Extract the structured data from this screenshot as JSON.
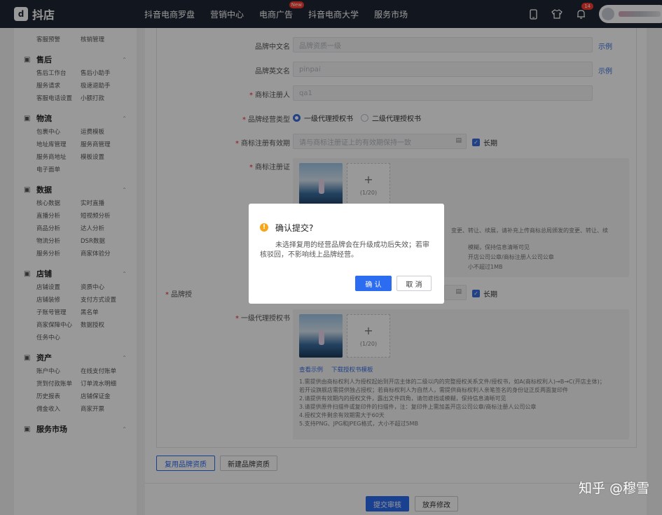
{
  "app": {
    "logo_text": "抖店"
  },
  "nav": {
    "items": [
      "抖音电商罗盘",
      "营销中心",
      "电商广告",
      "抖音电商大学",
      "服务市场"
    ],
    "new_badge": "New"
  },
  "topbar": {
    "notification_count": "14"
  },
  "sidebar": {
    "top_items": [
      "客服预警",
      "核销管理"
    ],
    "groups": [
      {
        "title": "售后",
        "icon": "after-sale-icon",
        "items": [
          "售后工作台",
          "售后小助手",
          "服务请求",
          "极速退助手",
          "客服电话设置",
          "小额打款"
        ]
      },
      {
        "title": "物流",
        "icon": "logistics-icon",
        "items": [
          "包裹中心",
          "运费模板",
          "地址库管理",
          "服务商管理",
          "服务商地址",
          "模板设置",
          "电子面单"
        ]
      },
      {
        "title": "数据",
        "icon": "data-icon",
        "items": [
          "核心数据",
          "实时直播",
          "直播分析",
          "短视频分析",
          "商品分析",
          "达人分析",
          "物流分析",
          "DSR数据",
          "服务分析",
          "商家体验分"
        ]
      },
      {
        "title": "店铺",
        "icon": "store-icon",
        "items": [
          "店铺设置",
          "资质中心",
          "店铺装修",
          "支付方式设置",
          "子账号管理",
          "黑名单",
          "商家保障中心",
          "数据授权",
          "任务中心"
        ]
      },
      {
        "title": "资产",
        "icon": "assets-icon",
        "items": [
          "账户中心",
          "在线支付账单",
          "货到付款账单",
          "订单流水明细",
          "历史报表",
          "店铺保证金",
          "佣金收入",
          "商家开票"
        ]
      },
      {
        "title": "服务市场",
        "icon": "service-icon",
        "items": []
      }
    ]
  },
  "form": {
    "brand_cn": {
      "label": "品牌中文名",
      "value": "品牌资质一级",
      "example": "示例"
    },
    "brand_en": {
      "label": "品牌英文名",
      "value": "pinpai",
      "example": "示例"
    },
    "registrant": {
      "label": "商标注册人",
      "value": "qa1"
    },
    "operation_type": {
      "label": "品牌经营类型",
      "option1": "一级代理授权书",
      "option2": "二级代理授权书"
    },
    "validity": {
      "label": "商标注册有效期",
      "placeholder": "请与商标注册证上的有效期保持一致",
      "long_term": "长期"
    },
    "certificate": {
      "label": "商标注册证",
      "count": "(1/20)"
    },
    "cert_notes": [
      "变更、转让、续展，请补充上传商标总局颁发的变更、转让、续",
      "模糊，保持信息清晰可见",
      "开店公司公章/商标注册人公司公章",
      "小不超过1MB"
    ],
    "auth_validity": {
      "label": "品牌授",
      "long_term": "长期"
    },
    "auth_letter": {
      "label": "一级代理授权书",
      "count": "(1/20)",
      "view_example": "查看示例",
      "download_template": "下载授权书模板"
    },
    "auth_notes": [
      "1.需提供由商标权利人为授权起始到开店主体的二级以内的完整授权关系文件/授权书，如A(商标权利人)→B→C(开店主体)；",
      "   若开设旗舰店需提供独占授权；若商标权利人为自然人，需提供商标权利人亲笔签名的身份证正反两面复印件",
      "2.请提供有效期内的授权文件，露出文件四角，请勿遮挡或模糊，保持信息清晰可见",
      "3.请提供原件扫描件或复印件的扫描件，注：复印件上需加盖开店公司公章/商标注册人公司公章",
      "4.授权文件剩余有效期需大于60天",
      "5.支持PNG、JPG和JPEG格式，大小不超过5MB"
    ],
    "reuse_button": "复用品牌资质",
    "new_button": "新建品牌资质",
    "submit_button": "提交审核",
    "discard_button": "放弃修改"
  },
  "dialog": {
    "title": "确认提交?",
    "body": "未选择复用的经营品牌会在升级成功后失效；若审核驳回，不影响线上品牌经营。",
    "confirm": "确 认",
    "cancel": "取 消"
  },
  "watermark": {
    "text": "知乎 @穆雪"
  },
  "colors": {
    "primary": "#2c6cf0",
    "topbar": "#1f2532",
    "warning": "#f7a51b",
    "required": "#f5222d"
  }
}
